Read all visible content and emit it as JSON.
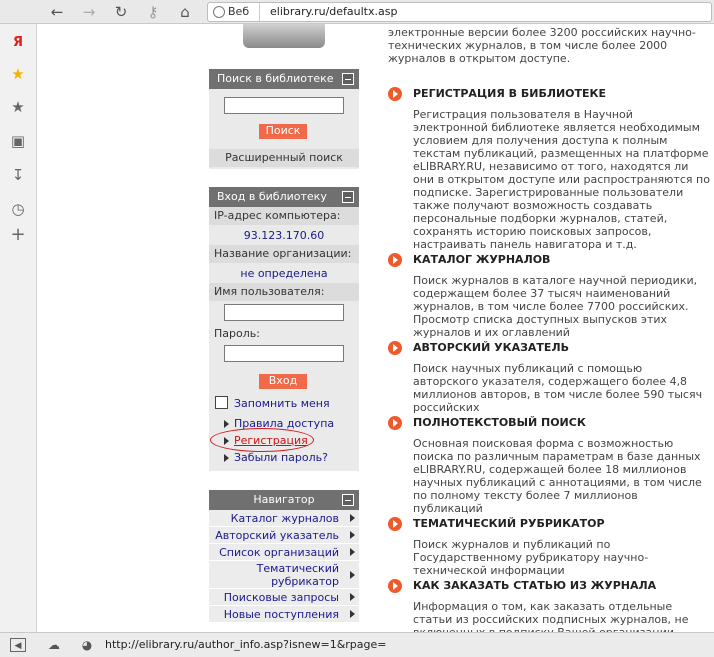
{
  "browser": {
    "address_prefix": "Веб",
    "url": "elibrary.ru/defaultx.asp",
    "status_url": "http://elibrary.ru/author_info.asp?isnew=1&rpage="
  },
  "intro_text": "электронные версии более 3200 российских научно-технических журналов, в том числе более 2000 журналов в открытом доступе.",
  "search_box": {
    "title": "Поиск в библиотеке",
    "search_button": "Поиск",
    "advanced_link": "Расширенный поиск"
  },
  "login_box": {
    "title": "Вход в библиотеку",
    "ip_label": "IP-адрес компьютера:",
    "ip_value": "93.123.170.60",
    "org_label": "Название организации:",
    "org_value": "не определена",
    "username_label": "Имя пользователя:",
    "password_label": "Пароль:",
    "login_button": "Вход",
    "remember_label": "Запомнить меня",
    "links": [
      "Правила доступа",
      "Регистрация",
      "Забыли пароль?"
    ]
  },
  "navigator": {
    "title": "Навигатор",
    "items": [
      "Каталог журналов",
      "Авторский указатель",
      "Список организаций",
      "Тематический рубрикатор",
      "Поисковые запросы",
      "Новые поступления"
    ]
  },
  "sections": [
    {
      "title": "РЕГИСТРАЦИЯ В БИБЛИОТЕКЕ",
      "text": "Регистрация пользователя в Научной электронной библиотеке является необходимым условием для получения доступа к полным текстам публикаций, размещенных на платформе eLIBRARY.RU, независимо от того, находятся ли они в открытом доступе или распространяются по подписке. Зарегистрированные пользователи также получают возможность создавать персональные подборки журналов, статей, сохранять историю поисковых запросов, настраивать панель навигатора и т.д."
    },
    {
      "title": "КАТАЛОГ ЖУРНАЛОВ",
      "text": "Поиск журналов в каталоге научной периодики, содержащем более 37 тысяч наименований журналов, в том числе более 7700 российских. Просмотр списка доступных выпусков этих журналов и их оглавлений"
    },
    {
      "title": "АВТОРСКИЙ УКАЗАТЕЛЬ",
      "text": "Поиск научных публикаций с помощью авторского указателя, содержащего более 4,8 миллионов авторов, в том числе более 590 тысяч российских"
    },
    {
      "title": "ПОЛНОТЕКСТОВЫЙ ПОИСК",
      "text": "Основная поисковая форма с возможностью поиска по различным параметрам в базе данных eLIBRARY.RU, содержащей более 18 миллионов научных публикаций с аннотациями, в том числе по полному тексту более 7 миллионов публикаций"
    },
    {
      "title": "ТЕМАТИЧЕСКИЙ РУБРИКАТОР",
      "text": "Поиск журналов и публикаций по Государственному рубрикатору научно-технической информации"
    },
    {
      "title": "КАК ЗАКАЗАТЬ СТАТЬЮ ИЗ ЖУРНАЛА",
      "text": "Информация о том, как заказать отдельные статьи из российских подписных журналов, не включенных в подписку Вашей организации"
    }
  ],
  "colors": {
    "accent": "#ef5a2a",
    "header": "#707070",
    "link": "#1a1a8a",
    "annotation": "#cc1111"
  }
}
